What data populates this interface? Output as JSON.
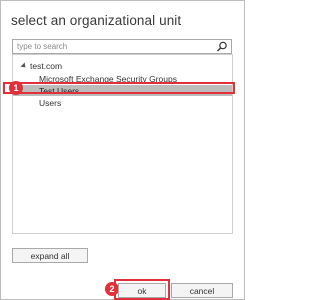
{
  "dialog": {
    "title": "select an organizational unit"
  },
  "search": {
    "placeholder": "type to search",
    "icon": "search-icon"
  },
  "tree": {
    "root": {
      "label": "test.com",
      "icon": "expanded-caret-icon"
    },
    "children": [
      {
        "label": "Microsoft Exchange Security Groups",
        "selected": false
      },
      {
        "label": "Test Users",
        "selected": true
      },
      {
        "label": "Users",
        "selected": false
      }
    ]
  },
  "buttons": {
    "expand_all": "expand all",
    "ok": "ok",
    "cancel": "cancel"
  },
  "annotations": {
    "step1": "1",
    "step2": "2",
    "highlight_color": "#e0313a"
  },
  "colors": {
    "selection": "#bcbcbc",
    "border": "#a9a9a9"
  }
}
